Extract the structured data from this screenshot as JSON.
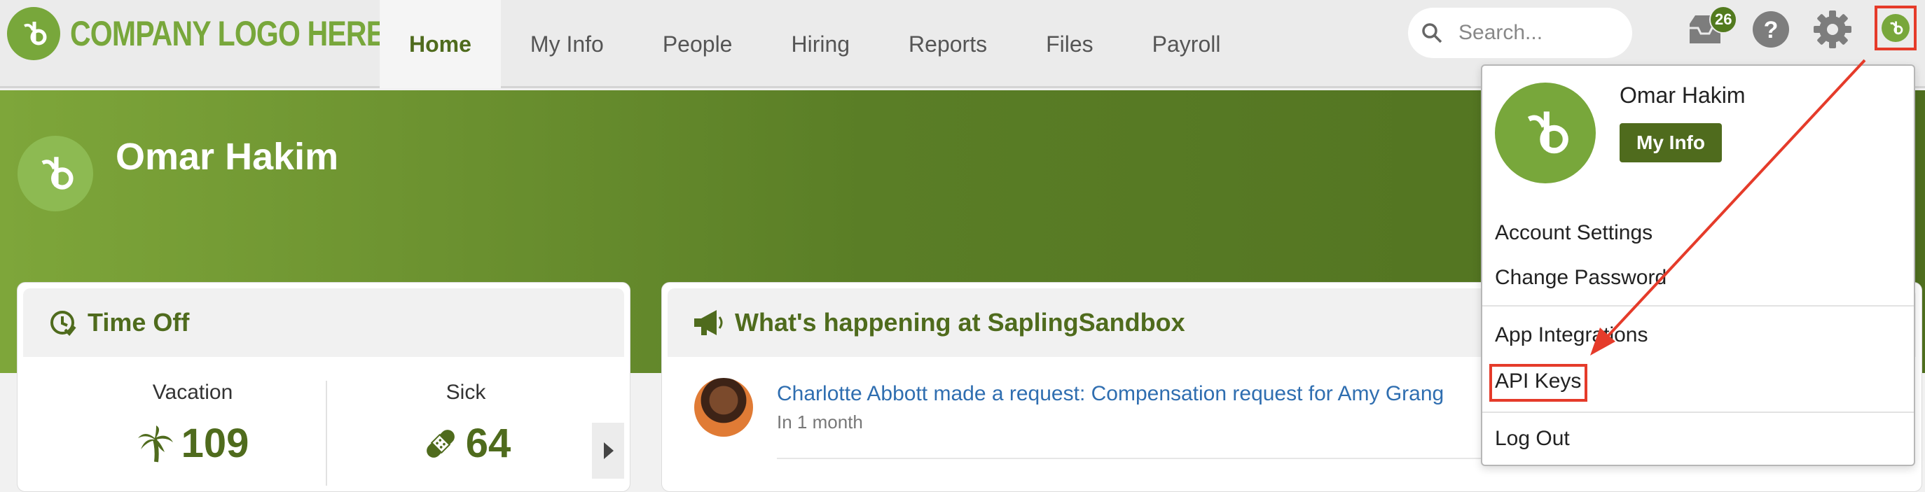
{
  "header": {
    "logo_text": "COMPANY LOGO HERE",
    "nav": [
      {
        "label": "Home",
        "active": true
      },
      {
        "label": "My Info"
      },
      {
        "label": "People"
      },
      {
        "label": "Hiring"
      },
      {
        "label": "Reports"
      },
      {
        "label": "Files"
      },
      {
        "label": "Payroll"
      }
    ],
    "search_placeholder": "Search...",
    "inbox_badge": "26",
    "icons": [
      "inbox-icon",
      "help-icon",
      "gear-icon",
      "user-avatar-icon"
    ]
  },
  "banner": {
    "name": "Omar Hakim"
  },
  "time_off": {
    "title": "Time Off",
    "vacation_label": "Vacation",
    "vacation_value": "109",
    "sick_label": "Sick",
    "sick_value": "64"
  },
  "happening": {
    "title": "What's happening at SaplingSandbox",
    "item_title": "Charlotte Abbott made a request: Compensation request for Amy Grang",
    "item_time": "In 1 month"
  },
  "dropdown": {
    "name": "Omar Hakim",
    "my_info_button": "My Info",
    "items": [
      "Account Settings",
      "Change Password",
      "App Integrations",
      "API Keys",
      "Log Out"
    ]
  },
  "colors": {
    "brand_green": "#78a73b",
    "dark_green": "#4f6b1d",
    "annotation_red": "#e53b2a",
    "link_blue": "#2f6eb0"
  }
}
